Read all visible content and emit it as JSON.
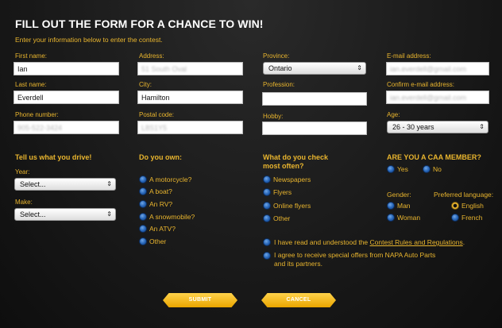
{
  "header": {
    "title": "FILL OUT THE FORM FOR A CHANCE TO WIN!",
    "subtitle": "Enter your information below to enter the contest."
  },
  "fields": {
    "first_name": {
      "label": "First name:",
      "value": "Ian"
    },
    "last_name": {
      "label": "Last name:",
      "value": "Everdell"
    },
    "phone": {
      "label": "Phone number:",
      "value": "905-522-3424"
    },
    "address": {
      "label": "Address:",
      "value": "51 South Oval"
    },
    "city": {
      "label": "City:",
      "value": "Hamilton"
    },
    "postal": {
      "label": "Postal code:",
      "value": "L8S1Y5"
    },
    "province": {
      "label": "Province:",
      "value": "Ontario"
    },
    "profession": {
      "label": "Profession:",
      "value": ""
    },
    "hobby": {
      "label": "Hobby:",
      "value": ""
    },
    "email": {
      "label": "E-mail address:",
      "value": "ian.everdell@gmail.com"
    },
    "confirm_email": {
      "label": "Confirm e-mail address:",
      "value": "ian.everdell@gmail.com"
    },
    "age": {
      "label": "Age:",
      "value": "26 - 30 years"
    }
  },
  "drive": {
    "heading": "Tell us what you drive!",
    "year_label": "Year:",
    "year_value": "Select...",
    "make_label": "Make:",
    "make_value": "Select..."
  },
  "own": {
    "heading": "Do you own:",
    "options": [
      "A motorcycle?",
      "A boat?",
      "An RV?",
      "A snowmobile?",
      "An ATV?",
      "Other"
    ]
  },
  "check": {
    "heading_line1": "What do you check",
    "heading_line2": "most often?",
    "options": [
      "Newspapers",
      "Flyers",
      "Online flyers",
      "Other"
    ]
  },
  "caa": {
    "heading": "ARE YOU A CAA MEMBER?",
    "yes": "Yes",
    "no": "No"
  },
  "gender": {
    "label": "Gender:",
    "man": "Man",
    "woman": "Woman"
  },
  "language": {
    "label": "Preferred language:",
    "english": "English",
    "french": "French",
    "selected": "English"
  },
  "agree": {
    "rules_prefix": "I have read and understood the ",
    "rules_link": "Contest Rules and Regulations",
    "rules_suffix": ".",
    "offers_line1": "I agree to receive special offers from NAPA Auto Parts",
    "offers_line2": "and its partners."
  },
  "buttons": {
    "submit": "SUBMIT",
    "cancel": "CANCEL"
  },
  "colors": {
    "accent": "#e9b52e",
    "radio": "#2463b6",
    "background": "#1c1c1c"
  }
}
